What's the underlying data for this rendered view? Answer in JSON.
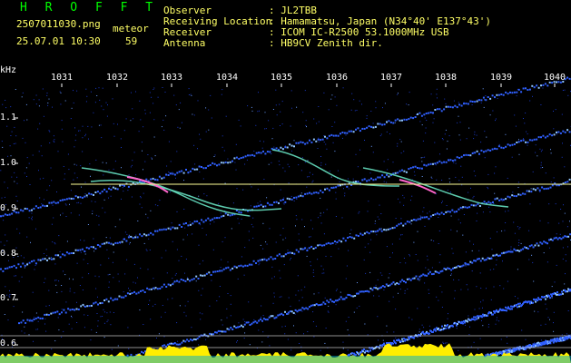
{
  "header": {
    "app_name": "H R O F F T",
    "filename": "2507011030.png",
    "timestamp": "25.07.01 10:30",
    "meteor_label": "meteor",
    "meteor_count": "59",
    "info_labels": [
      "Observer",
      "Receiving Location",
      "Receiver",
      "Antenna"
    ],
    "info_values": [
      ": JL2TBB",
      ": Hamamatsu, Japan (N34°40' E137°43')",
      ": ICOM IC-R2500 53.1000MHz USB",
      ": HB9CV Zenith dir."
    ]
  },
  "axes": {
    "y_unit": "kHz",
    "top_ticks": [
      "1031",
      "1032",
      "1033",
      "1034",
      "1035",
      "1036",
      "1037",
      "1038",
      "1039",
      "1040"
    ],
    "left_ticks": [
      "1.1",
      "1.0",
      "0.9",
      "0.8",
      "0.7",
      "0.6"
    ]
  },
  "colors": {
    "background": "#000000",
    "header_green": "#00ff00",
    "header_yellow": "#ffff66",
    "trace_blue": "#3060ff",
    "reference_line": "#ffff99",
    "spectrum_yellow": "#ffee00"
  }
}
